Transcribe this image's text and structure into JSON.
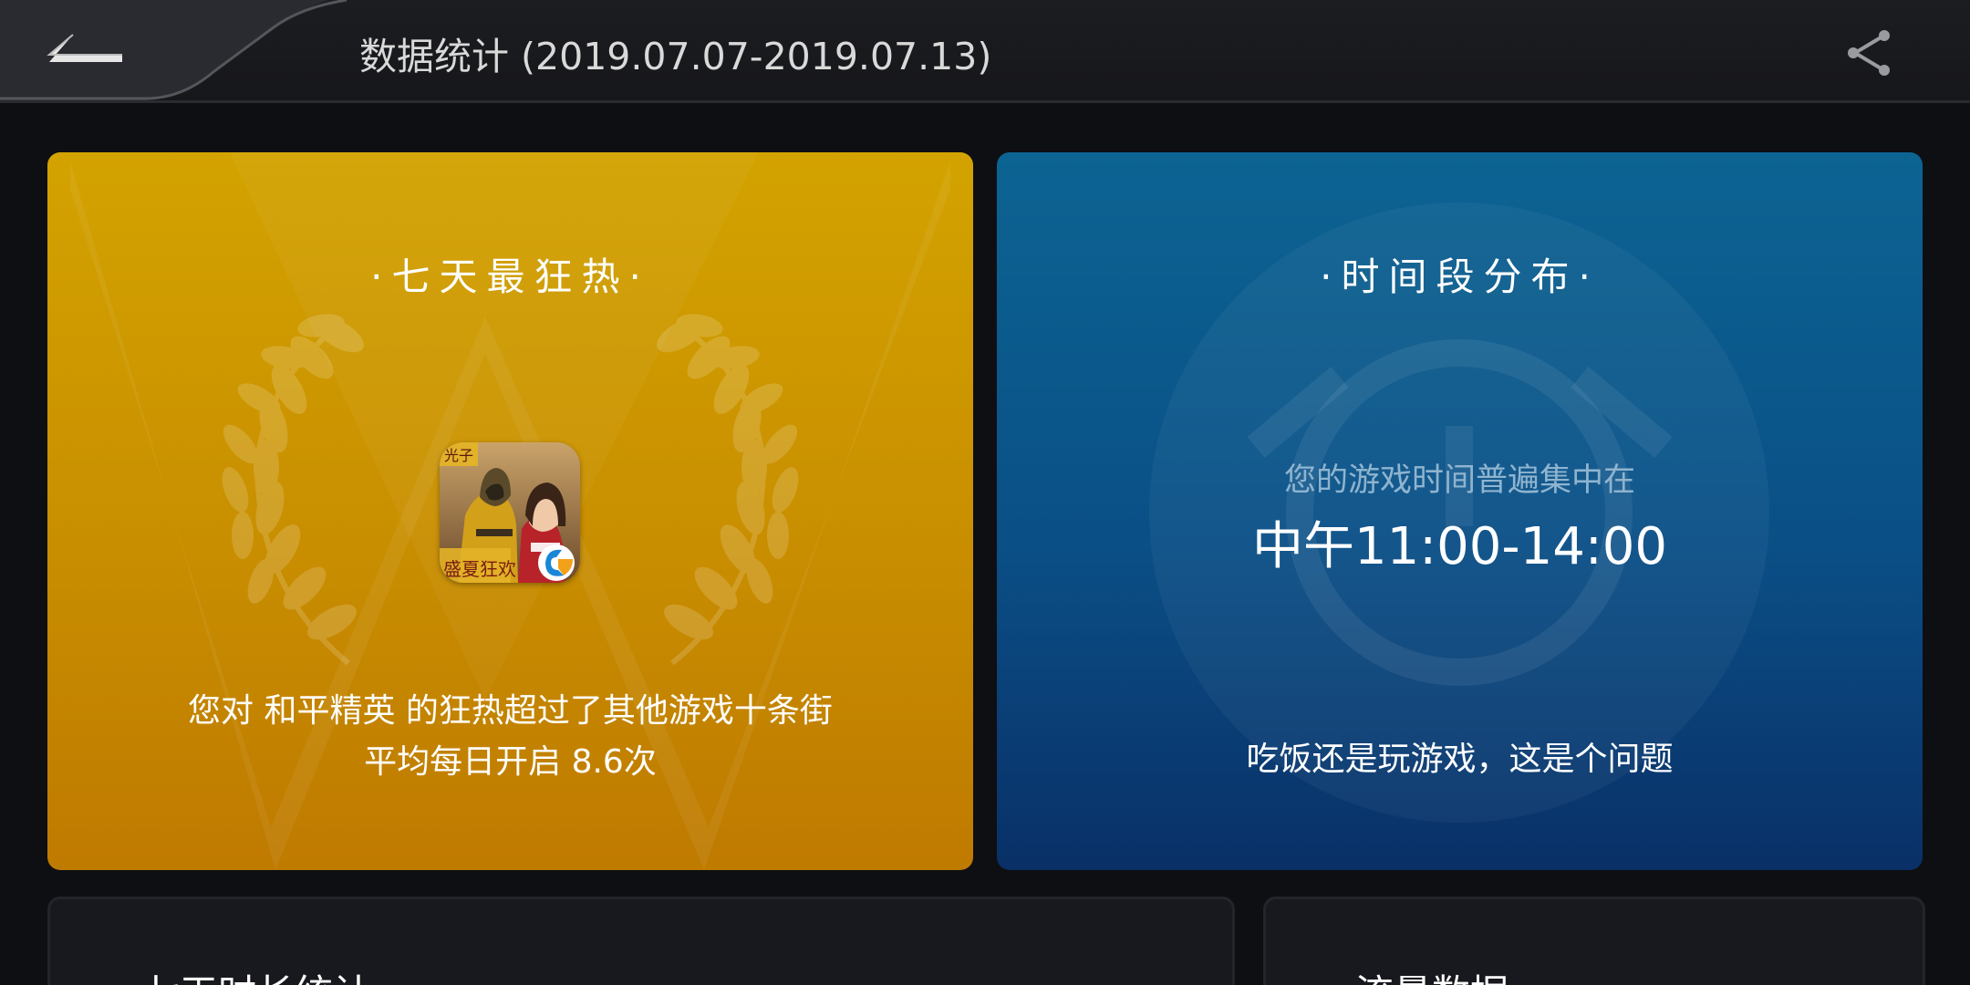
{
  "header": {
    "title": "数据统计 (2019.07.07-2019.07.13)"
  },
  "hot_card": {
    "title": "·七天最狂热·",
    "game_icon": "peace-elite-game-icon",
    "line1": "您对 和平精英 的狂热超过了其他游戏十条街",
    "line2": "平均每日开启 8.6次"
  },
  "time_card": {
    "title": "·时间段分布·",
    "subtitle": "您的游戏时间普遍集中在",
    "time_range": "中午11:00-14:00",
    "footer": "吃饭还是玩游戏，这是个问题"
  },
  "bottom": {
    "left_title": "七天时长统计",
    "right_title": "流量数据"
  },
  "colors": {
    "gold_card": "#c88e00",
    "blue_card": "#0a4f86",
    "background": "#0e0f12"
  }
}
